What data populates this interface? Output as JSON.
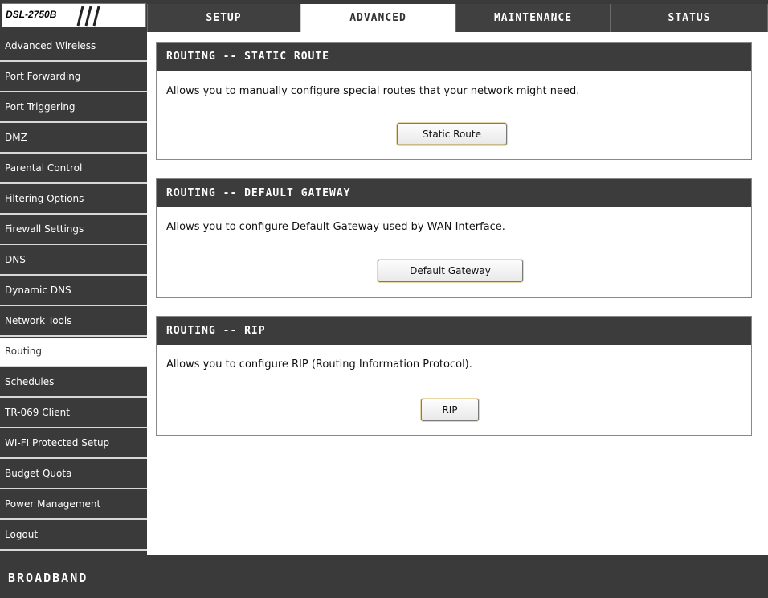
{
  "header": {
    "model": "DSL-2750B",
    "tabs": [
      {
        "label": "SETUP"
      },
      {
        "label": "ADVANCED"
      },
      {
        "label": "MAINTENANCE"
      },
      {
        "label": "STATUS"
      }
    ],
    "active_tab": "ADVANCED"
  },
  "sidebar": {
    "items": [
      {
        "label": "Advanced Wireless"
      },
      {
        "label": "Port Forwarding"
      },
      {
        "label": "Port Triggering"
      },
      {
        "label": "DMZ"
      },
      {
        "label": "Parental Control"
      },
      {
        "label": "Filtering Options"
      },
      {
        "label": "Firewall Settings"
      },
      {
        "label": "DNS"
      },
      {
        "label": "Dynamic DNS"
      },
      {
        "label": "Network Tools"
      },
      {
        "label": "Routing"
      },
      {
        "label": "Schedules"
      },
      {
        "label": "TR-069 Client"
      },
      {
        "label": "WI-FI Protected Setup"
      },
      {
        "label": "Budget Quota"
      },
      {
        "label": "Power Management"
      },
      {
        "label": "Logout"
      }
    ],
    "active_item": "Routing"
  },
  "panels": {
    "static_route": {
      "title": "ROUTING -- STATIC ROUTE",
      "description": "Allows you to manually configure special routes that your network might need.",
      "button": "Static Route"
    },
    "default_gateway": {
      "title": "ROUTING -- DEFAULT GATEWAY",
      "description": "Allows you to configure Default Gateway used by WAN Interface.",
      "button": "Default Gateway"
    },
    "rip": {
      "title": "ROUTING -- RIP",
      "description": "Allows you to configure RIP (Routing Information Protocol).",
      "button": "RIP"
    }
  },
  "footer": {
    "brand": "BROADBAND"
  },
  "colors": {
    "dark_bar": "#3a3a3a",
    "panel_header": "#3c3c3c",
    "active_bg": "#ffffff"
  }
}
